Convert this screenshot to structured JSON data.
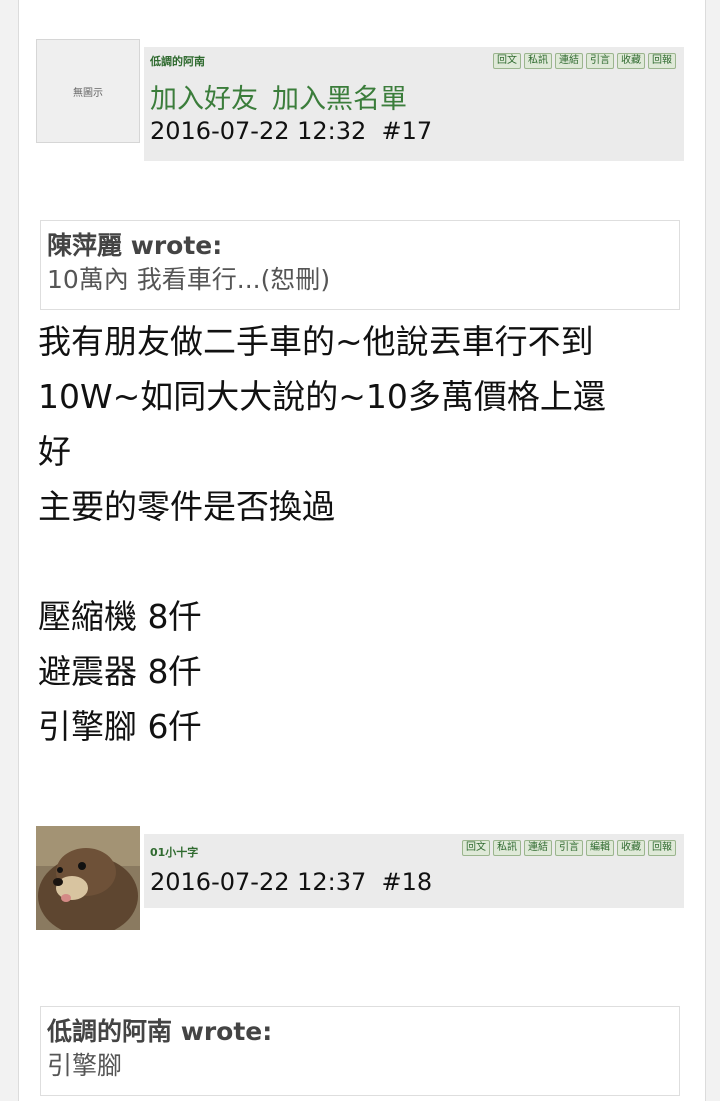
{
  "post17": {
    "avatar_text": "無圖示",
    "username": "低調的阿南",
    "actions": [
      "回文",
      "私訊",
      "連結",
      "引言",
      "收藏",
      "回報"
    ],
    "add_friend": "加入好友",
    "add_blacklist": "加入黑名單",
    "datetime": "2016-07-22 12:32",
    "floor": "#17",
    "quote": {
      "author": "陳萍麗",
      "wrote": "wrote:",
      "text": "10萬內 我看車行...(恕刪)"
    },
    "body": [
      "我有朋友做二手車的~他說丟車行不到",
      "10W~如同大大說的~10多萬價格上還",
      "好",
      "主要的零件是否換過",
      "",
      "壓縮機 8仟",
      "避震器 8仟",
      "引擎腳 6仟"
    ]
  },
  "post18": {
    "username": "01小十字",
    "actions": [
      "回文",
      "私訊",
      "連結",
      "引言",
      "編輯",
      "收藏",
      "回報"
    ],
    "datetime": "2016-07-22 12:37",
    "floor": "#18",
    "quote": {
      "author": "低調的阿南",
      "wrote": "wrote:",
      "text": "引擎腳"
    }
  }
}
